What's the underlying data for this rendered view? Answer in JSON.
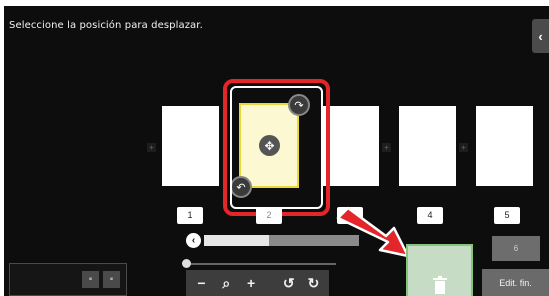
{
  "instruction": "Seleccione la posición para desplazar.",
  "panel": {
    "collapse_glyph": "‹",
    "collapse_icon": "chevron-left-icon"
  },
  "pages": [
    {
      "number": "1",
      "selected": false
    },
    {
      "number": "2",
      "selected": true
    },
    {
      "number": "3",
      "selected": false
    },
    {
      "number": "4",
      "selected": false
    },
    {
      "number": "5",
      "selected": false
    }
  ],
  "handles": {
    "move_icon": "move-icon",
    "move_glyph": "✥",
    "rotate_glyph_top": "↷",
    "rotate_glyph_bottom": "↶"
  },
  "gap_marker": "+",
  "scroll": {
    "left_glyph": "‹",
    "position": 0.42
  },
  "zoom": {
    "level": 0.0
  },
  "toolbar": {
    "zoom_out": "−",
    "zoom_glyph": "⌕",
    "zoom_in": "+",
    "rotate_left": "↺",
    "rotate_right": "↻"
  },
  "buttons": {
    "page_six": "6",
    "edit_finish": "Edit. fin."
  },
  "colors": {
    "highlight": "#e3262a",
    "selection": "#e8d63a",
    "trash_zone": "#c6dcc4",
    "arrow": "#e3262a"
  }
}
